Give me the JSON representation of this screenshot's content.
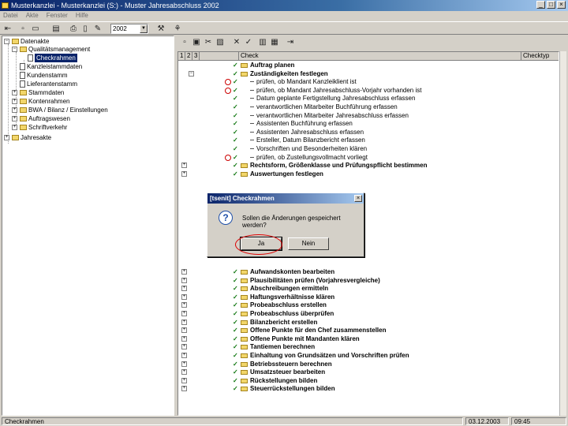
{
  "window": {
    "title": "Musterkanzlei - Musterkanzlei (S:) - Muster Jahresabschluss 2002",
    "minimize": "_",
    "maximize": "□",
    "close": "×"
  },
  "menu": [
    "Datei",
    "Akte",
    "Fenster",
    "Hilfe"
  ],
  "toolbar": {
    "year": "2002"
  },
  "tree": {
    "items": [
      {
        "label": "Datenakte",
        "expander": "−"
      },
      {
        "label": "Qualitätsmanagement",
        "expander": "−"
      },
      {
        "label": "Checkrahmen",
        "expander": ""
      },
      {
        "label": "Kanzleistammdaten",
        "expander": ""
      },
      {
        "label": "Kundenstamm",
        "expander": ""
      },
      {
        "label": "Lieferantenstamm",
        "expander": ""
      },
      {
        "label": "Stammdaten",
        "expander": "+"
      },
      {
        "label": "Kontenrahmen",
        "expander": "+"
      },
      {
        "label": "BWA / Bilanz / Einstellungen",
        "expander": "+"
      },
      {
        "label": "Auftragswesen",
        "expander": "+"
      },
      {
        "label": "Schriftverkehr",
        "expander": "+"
      },
      {
        "label": "Jahresakte",
        "expander": "+"
      }
    ]
  },
  "grid": {
    "headers": [
      "1",
      "2",
      "3",
      "Check",
      "Checktyp"
    ],
    "rows": [
      {
        "text": "Auftrag planen",
        "bold": true
      },
      {
        "text": "Zuständigkeiten festlegen",
        "bold": true
      },
      {
        "text": "prüfen, ob Mandant Kanzleiklient ist",
        "bold": false
      },
      {
        "text": "prüfen, ob Mandant Jahresabschluss-Vorjahr vorhanden ist",
        "bold": false
      },
      {
        "text": "Datum geplante Fertigstellung Jahresabschluss erfassen",
        "bold": false
      },
      {
        "text": "verantwortlichen Mitarbeiter Buchführung erfassen",
        "bold": false
      },
      {
        "text": "verantwortlichen Mitarbeiter Jahresabschluss erfassen",
        "bold": false
      },
      {
        "text": "Assistenten Buchführung erfassen",
        "bold": false
      },
      {
        "text": "Assistenten Jahresabschluss erfassen",
        "bold": false
      },
      {
        "text": "Ersteller, Datum Bilanzbericht erfassen",
        "bold": false
      },
      {
        "text": "Vorschriften und Besonderheiten klären",
        "bold": false
      },
      {
        "text": "prüfen, ob Zustellungsvollmacht vorliegt",
        "bold": false
      },
      {
        "text": "Rechtsform, Größenklasse und Prüfungspflicht bestimmen",
        "bold": true
      },
      {
        "text": "Auswertungen festlegen",
        "bold": true
      },
      {
        "text": "Aufwandskonten bearbeiten",
        "bold": true
      },
      {
        "text": "Plausibilitäten prüfen (Vorjahresvergleiche)",
        "bold": true
      },
      {
        "text": "Abschreibungen ermitteln",
        "bold": true
      },
      {
        "text": "Haftungsverhältnisse klären",
        "bold": true
      },
      {
        "text": "Probeabschluss erstellen",
        "bold": true
      },
      {
        "text": "Probeabschluss überprüfen",
        "bold": true
      },
      {
        "text": "Bilanzbericht erstellen",
        "bold": true
      },
      {
        "text": "Offene Punkte für den Chef zusammenstellen",
        "bold": true
      },
      {
        "text": "Offene Punkte mit Mandanten klären",
        "bold": true
      },
      {
        "text": "Tantiemen berechnen",
        "bold": true
      },
      {
        "text": "Einhaltung von Grundsätzen und Vorschriften prüfen",
        "bold": true
      },
      {
        "text": "Betriebssteuern berechnen",
        "bold": true
      },
      {
        "text": "Umsatzsteuer bearbeiten",
        "bold": true
      },
      {
        "text": "Rückstellungen bilden",
        "bold": true
      },
      {
        "text": "Steuerrückstellungen bilden",
        "bold": true
      }
    ]
  },
  "dialog": {
    "title": "[tsenit] Checkrahmen",
    "close": "×",
    "icon": "?",
    "message": "Sollen die Änderungen gespeichert werden?",
    "yes_label": "Ja",
    "no_label": "Nein"
  },
  "status": {
    "left": "Checkrahmen",
    "date": "03.12.2003",
    "time": "09:45"
  },
  "colors": {
    "title_start": "#0a246a",
    "title_end": "#a6caf0",
    "check_green": "#117711",
    "annotation_red": "#dd0000"
  }
}
